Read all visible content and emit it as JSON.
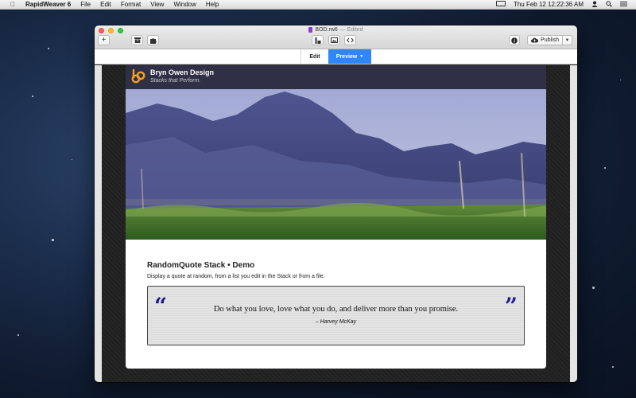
{
  "menubar": {
    "app_name": "RapidWeaver 6",
    "items": [
      "File",
      "Edit",
      "Format",
      "View",
      "Window",
      "Help"
    ],
    "clock": "Thu Feb 12  12:22:36 AM"
  },
  "window": {
    "doc_name": "BOD.rw6",
    "doc_status": "— Edited",
    "add_label": "+",
    "publish_label": "Publish",
    "tabs": {
      "edit": "Edit",
      "preview": "Preview"
    }
  },
  "site": {
    "title": "Bryn Owen Design",
    "slogan": "Stacks that Perform."
  },
  "demo": {
    "title": "RandomQuote Stack • Demo",
    "description": "Display a quote at random, from a list you edit in the Stack or from a file.",
    "open_mark": "“",
    "close_mark": "”",
    "quote": "Do what you love, love what you do, and deliver more than you promise.",
    "author": "– Harvey McKay"
  },
  "colors": {
    "accent": "#2f86f6",
    "site_header": "#2f2f45",
    "quote_marks": "#1f1a8a",
    "logo": "#f0a020"
  }
}
